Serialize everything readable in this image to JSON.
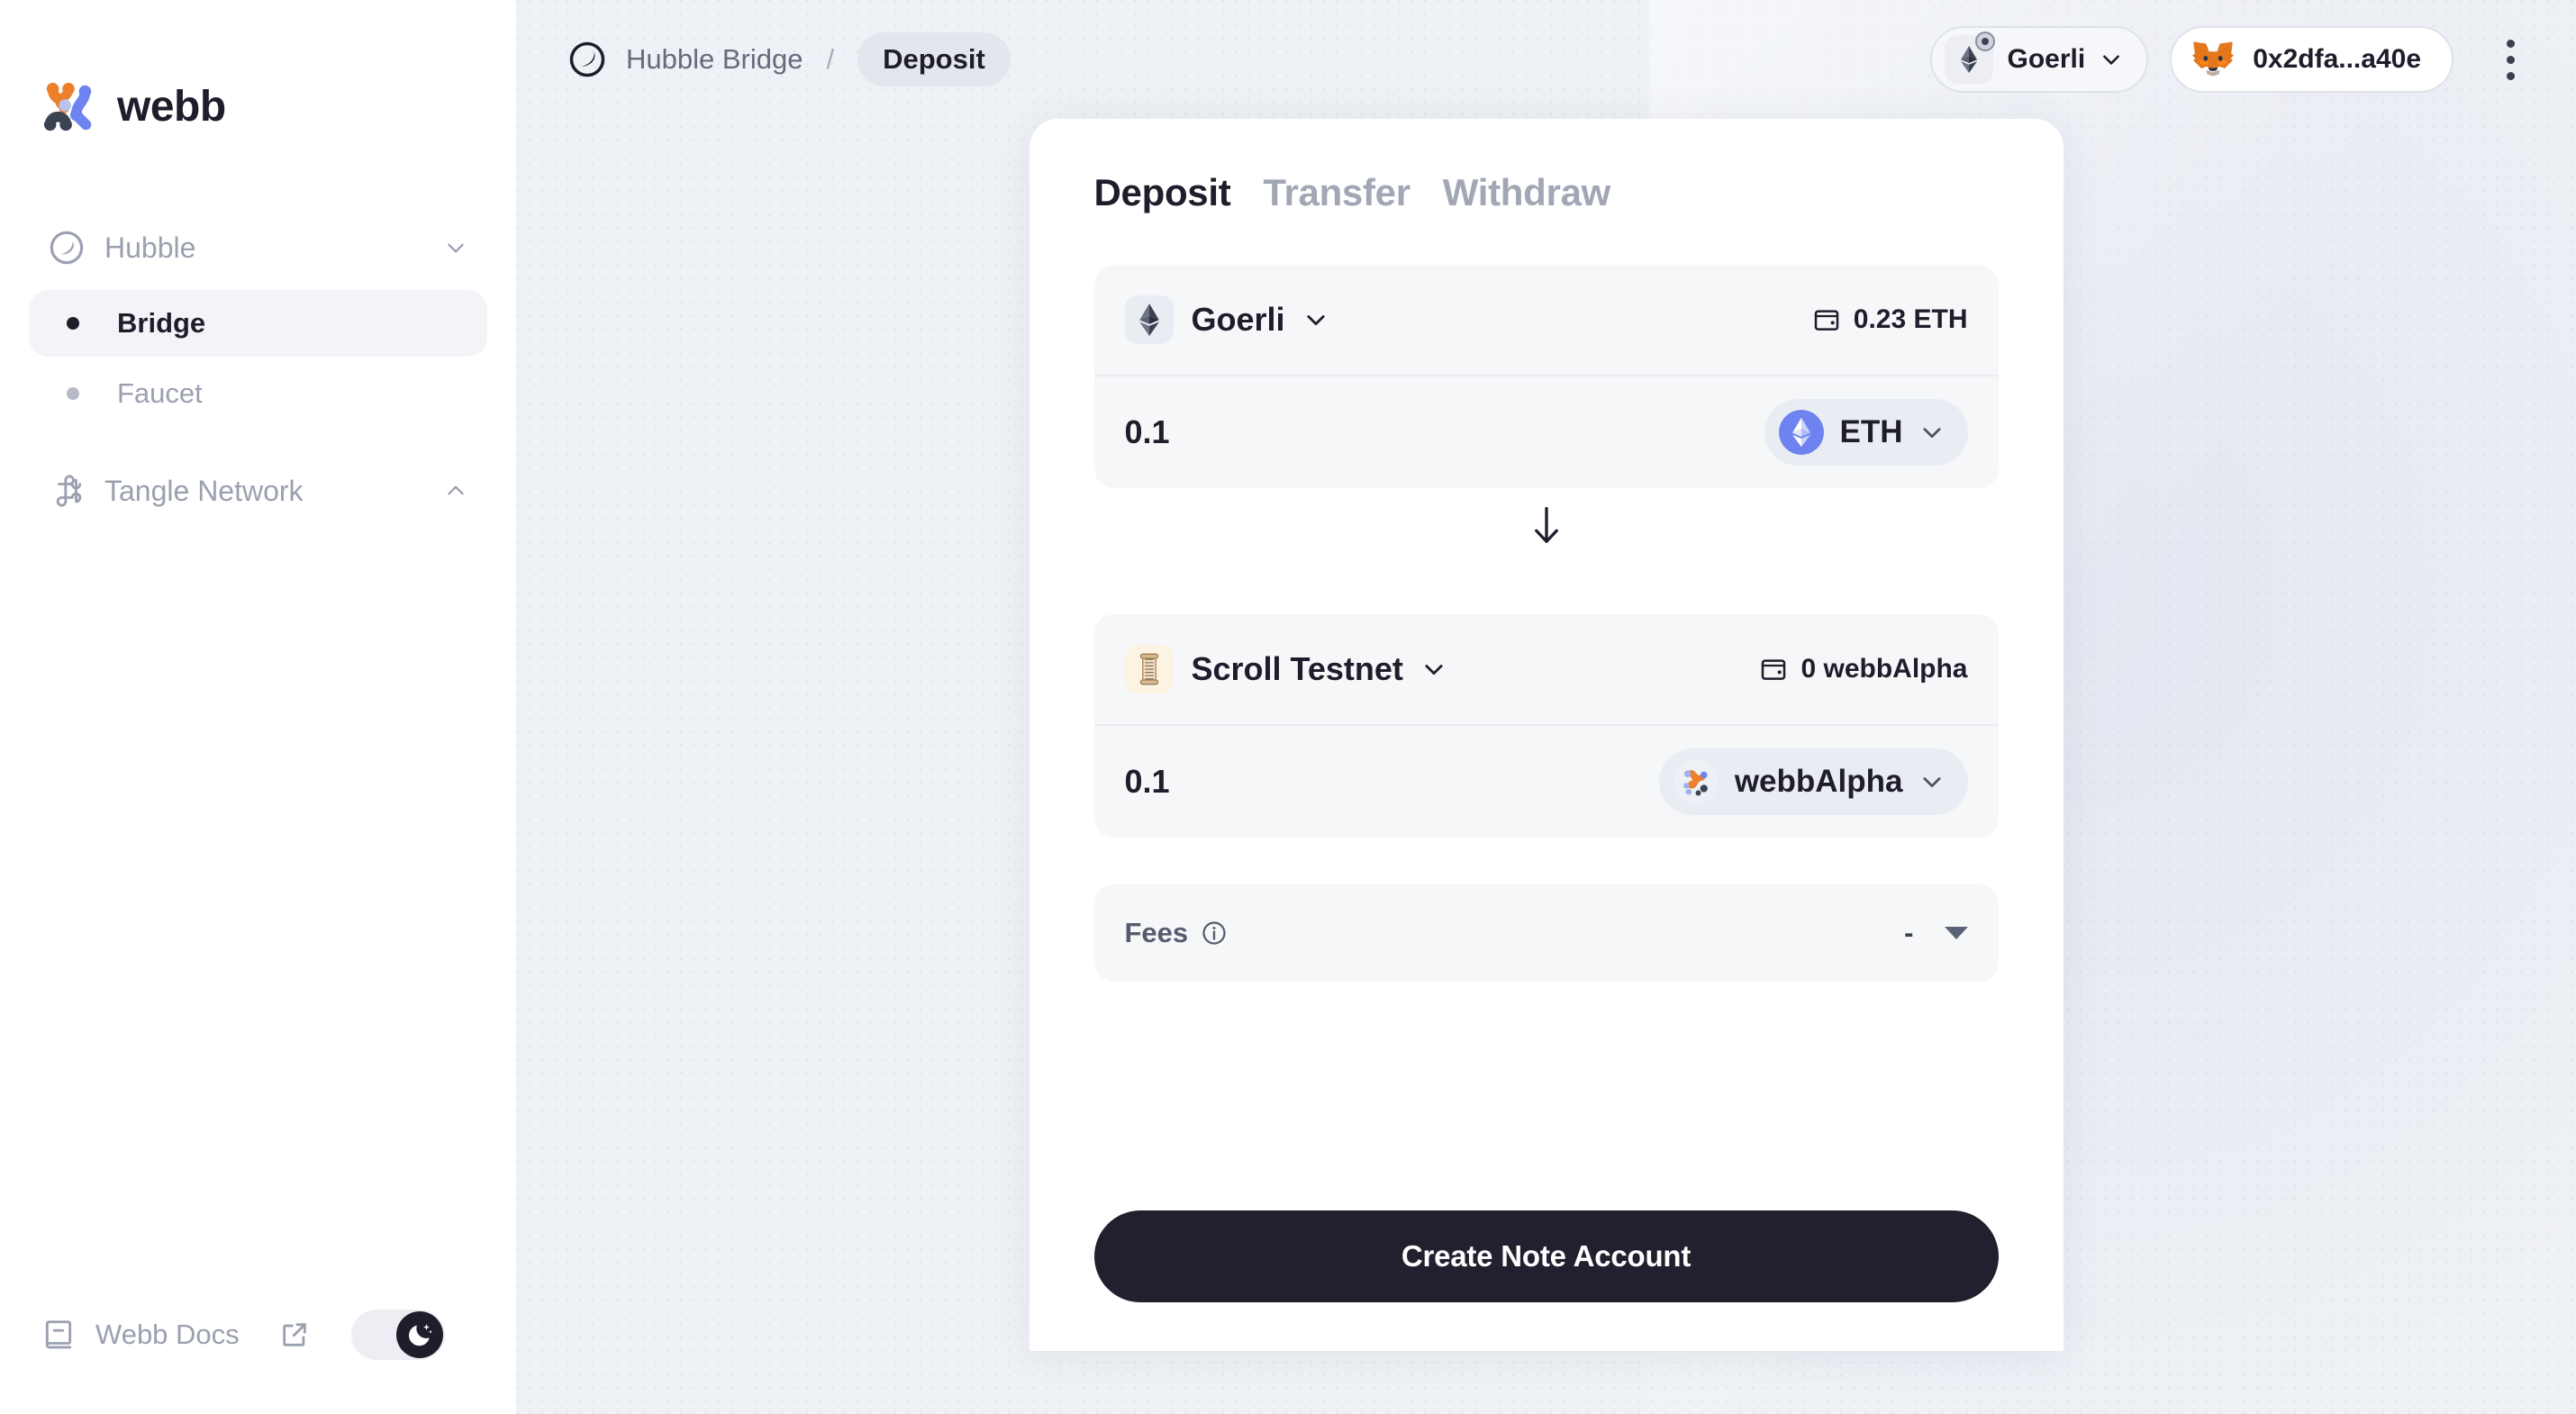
{
  "brand": {
    "name": "webb",
    "logo_icon": "webb-logo-icon"
  },
  "sidebar": {
    "groups": [
      {
        "label": "Hubble",
        "icon": "hubble-circle-icon",
        "chevron": "chevron-down-icon",
        "expanded": true,
        "items": [
          {
            "label": "Bridge",
            "active": true
          },
          {
            "label": "Faucet",
            "active": false
          }
        ]
      },
      {
        "label": "Tangle Network",
        "icon": "tangle-loop-icon",
        "chevron": "chevron-up-icon",
        "expanded": true,
        "items": []
      }
    ],
    "footer": {
      "docs_label": "Webb Docs",
      "book_icon": "book-icon",
      "external_icon": "external-link-icon",
      "theme_toggle": {
        "icon": "moon-stars-icon",
        "state": "dark"
      }
    }
  },
  "topbar": {
    "breadcrumb": {
      "icon": "hubble-circle-icon",
      "root": "Hubble Bridge",
      "separator": "/",
      "current": "Deposit"
    },
    "chain_selector": {
      "label": "Goerli",
      "icon": "ethereum-icon",
      "chevron": "chevron-down-icon"
    },
    "account": {
      "address": "0x2dfa...a40e",
      "icon": "metamask-fox-icon"
    },
    "menu_icon": "kebab-menu-icon"
  },
  "card": {
    "tabs": [
      {
        "label": "Deposit",
        "active": true
      },
      {
        "label": "Transfer",
        "active": false
      },
      {
        "label": "Withdraw",
        "active": false
      }
    ],
    "source": {
      "chain": "Goerli",
      "chain_icon": "ethereum-icon",
      "chain_chevron": "chevron-down-icon",
      "balance": "0.23 ETH",
      "balance_icon": "wallet-icon",
      "amount": "0.1",
      "amount_placeholder": "0",
      "token": "ETH",
      "token_icon": "ethereum-token-icon",
      "token_chevron": "chevron-down-icon"
    },
    "direction_icon": "arrow-down-icon",
    "destination": {
      "chain": "Scroll Testnet",
      "chain_icon": "scroll-icon",
      "chain_chevron": "chevron-down-icon",
      "balance": "0 webbAlpha",
      "balance_icon": "wallet-icon",
      "amount": "0.1",
      "amount_placeholder": "0",
      "token": "webbAlpha",
      "token_icon": "webb-token-icon",
      "token_chevron": "chevron-down-icon"
    },
    "fees": {
      "label": "Fees",
      "info_icon": "info-icon",
      "value": "-",
      "caret_icon": "caret-down-icon"
    },
    "cta_label": "Create Note Account"
  },
  "colors": {
    "accent_orange": "#ec802b",
    "accent_blue": "#6e82f0",
    "accent_dark": "#3a4352",
    "ink": "#1f1d2b",
    "muted": "#9ba0b0",
    "canvas": "#eef1f5",
    "panel": "#f6f7f9"
  }
}
